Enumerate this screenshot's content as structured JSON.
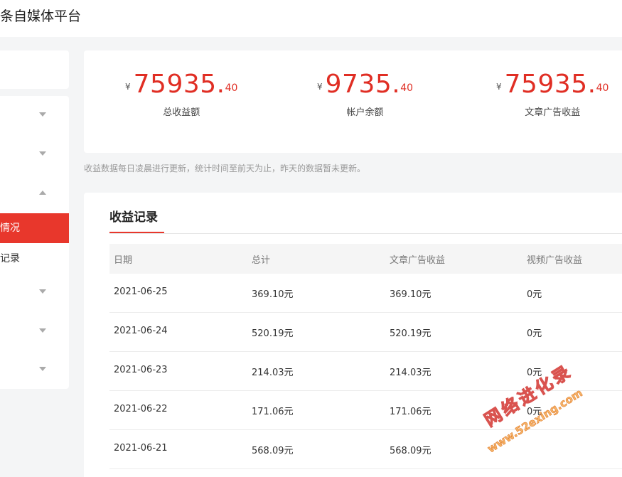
{
  "header": {
    "app_title": "条自媒体平台"
  },
  "sidebar": {
    "top_fragment": "",
    "items": [
      {
        "fragment": "",
        "chevron": "down"
      },
      {
        "fragment": "",
        "chevron": "down"
      },
      {
        "fragment": "",
        "chevron": "up"
      },
      {
        "fragment": "情况",
        "active": true
      },
      {
        "fragment": "记录"
      },
      {
        "fragment": "",
        "chevron": "down"
      },
      {
        "fragment": "",
        "chevron": "down"
      },
      {
        "fragment": "",
        "chevron": "down"
      }
    ]
  },
  "stats": [
    {
      "currency": "¥",
      "integer": "75935",
      "dot": ".",
      "decimal": "40",
      "label": "总收益额"
    },
    {
      "currency": "¥",
      "integer": "9735",
      "dot": ".",
      "decimal": "40",
      "label": "帐户余额"
    },
    {
      "currency": "¥",
      "integer": "75935",
      "dot": ".",
      "decimal": "40",
      "label": "文章广告收益"
    }
  ],
  "note": "收益数据每日凌晨进行更新，统计时间至前天为止，昨天的数据暂未更新。",
  "records": {
    "title": "收益记录",
    "columns": [
      "日期",
      "总计",
      "文章广告收益",
      "视频广告收益"
    ],
    "rows": [
      [
        "2021-06-25",
        "369.10元",
        "369.10元",
        "0元"
      ],
      [
        "2021-06-24",
        "520.19元",
        "520.19元",
        "0元"
      ],
      [
        "2021-06-23",
        "214.03元",
        "214.03元",
        "0元"
      ],
      [
        "2021-06-22",
        "171.06元",
        "171.06元",
        "0元"
      ],
      [
        "2021-06-21",
        "568.09元",
        "568.09元",
        ""
      ]
    ]
  },
  "watermark": {
    "line1": "网络进化录",
    "line2": "www.52exing.com"
  },
  "colors": {
    "accent": "#e8372c",
    "amount": "#e02e24"
  }
}
